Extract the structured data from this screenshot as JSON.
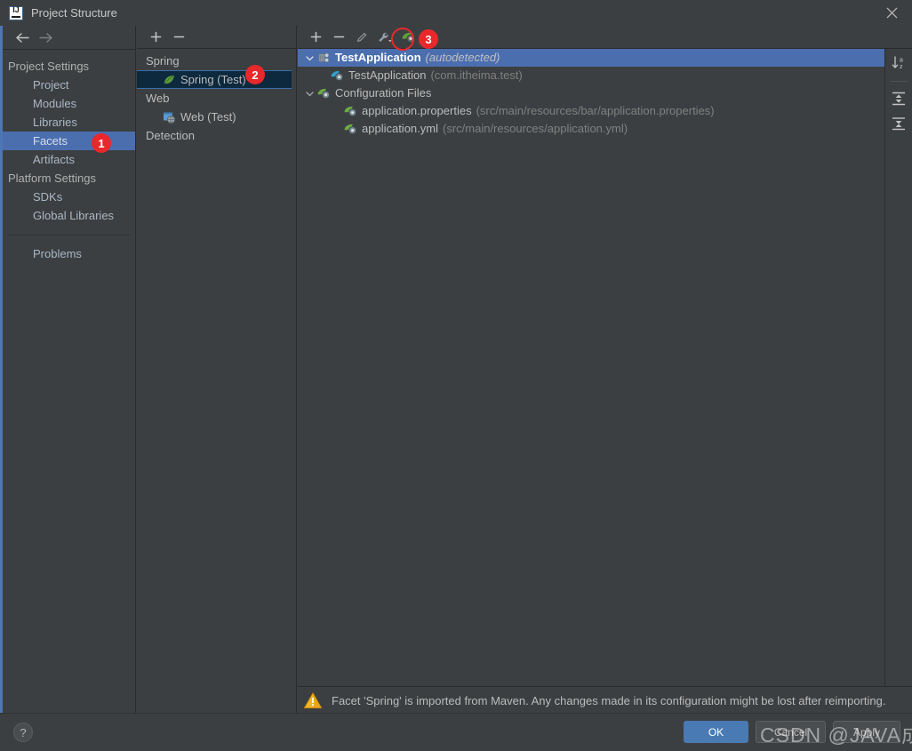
{
  "window": {
    "title": "Project Structure",
    "app_icon": "intellij-idea-icon",
    "close_icon": "close-icon"
  },
  "nav_toolbar": {
    "back_icon": "arrow-left-icon",
    "forward_icon": "arrow-right-icon"
  },
  "sidebar": {
    "sections": [
      {
        "label": "Project Settings",
        "type": "group"
      },
      {
        "label": "Project",
        "type": "child"
      },
      {
        "label": "Modules",
        "type": "child"
      },
      {
        "label": "Libraries",
        "type": "child"
      },
      {
        "label": "Facets",
        "type": "child",
        "selected": true
      },
      {
        "label": "Artifacts",
        "type": "child"
      },
      {
        "label": "Platform Settings",
        "type": "group"
      },
      {
        "label": "SDKs",
        "type": "child"
      },
      {
        "label": "Global Libraries",
        "type": "child"
      }
    ],
    "problems": "Problems"
  },
  "facets_panel": {
    "toolbar": {
      "add_icon": "plus-icon",
      "remove_icon": "minus-icon"
    },
    "items": [
      {
        "label": "Spring",
        "type": "group",
        "icon": "none"
      },
      {
        "label": "Spring (Test)",
        "type": "child",
        "icon": "spring-leaf-icon",
        "selected": true
      },
      {
        "label": "Web",
        "type": "group",
        "icon": "none"
      },
      {
        "label": "Web (Test)",
        "type": "child",
        "icon": "web-globe-icon"
      },
      {
        "label": "Detection",
        "type": "group",
        "icon": "none"
      }
    ]
  },
  "detail_panel": {
    "toolbar": {
      "add_icon": "plus-icon",
      "remove_icon": "minus-icon",
      "edit_icon": "pencil-icon",
      "settings_icon": "wrench-dropdown-icon",
      "autodetect_icon": "spring-bean-icon"
    },
    "side_toolbar": {
      "sort_icon": "sort-alpha-icon",
      "expand_icon": "expand-all-icon",
      "collapse_icon": "collapse-all-icon"
    },
    "tree": [
      {
        "id": "root",
        "label": "TestApplication",
        "note": "(autodetected)",
        "icon": "spring-context-icon",
        "twisty": "expanded",
        "indent": 0,
        "selected": true,
        "bold": true
      },
      {
        "id": "bean",
        "label": "TestApplication",
        "note": "(com.itheima.test)",
        "icon": "spring-java-bean-icon",
        "twisty": "none",
        "indent": 1
      },
      {
        "id": "configfiles",
        "label": "Configuration Files",
        "note": "",
        "icon": "spring-config-icon",
        "twisty": "expanded",
        "indent": 1
      },
      {
        "id": "appprops",
        "label": "application.properties",
        "note": "(src/main/resources/bar/application.properties)",
        "icon": "spring-config-icon",
        "twisty": "none",
        "indent": 2
      },
      {
        "id": "appyml",
        "label": "application.yml",
        "note": "(src/main/resources/application.yml)",
        "icon": "spring-config-icon",
        "twisty": "none",
        "indent": 2
      }
    ],
    "warning": {
      "icon": "warning-triangle-icon",
      "text": "Facet 'Spring' is imported from Maven. Any changes made in its configuration might be lost after reimporting."
    }
  },
  "footer": {
    "help_label": "?",
    "help_icon": "help-icon",
    "ok_label": "OK",
    "cancel_label": "Cancel",
    "apply_label": "Apply"
  },
  "annotations": {
    "badge1": "1",
    "badge2": "2",
    "badge3": "3",
    "highlight_ring": "autodetect-button-highlight"
  },
  "watermark": {
    "text": "CSDN @JAVA成神"
  },
  "colors": {
    "window_bg": "#3c3f41",
    "selection_blue": "#4b6eaf",
    "tree_selection_blue": "#4b6eaf",
    "facet_selection_navy": "#0d293e",
    "facet_selection_border": "#3b6ea8",
    "badge_red": "#e8282b",
    "primary_button": "#4a7ab3",
    "text": "#bbbbbb",
    "muted_text": "#808080",
    "accent_strip": "#4e76b5"
  }
}
